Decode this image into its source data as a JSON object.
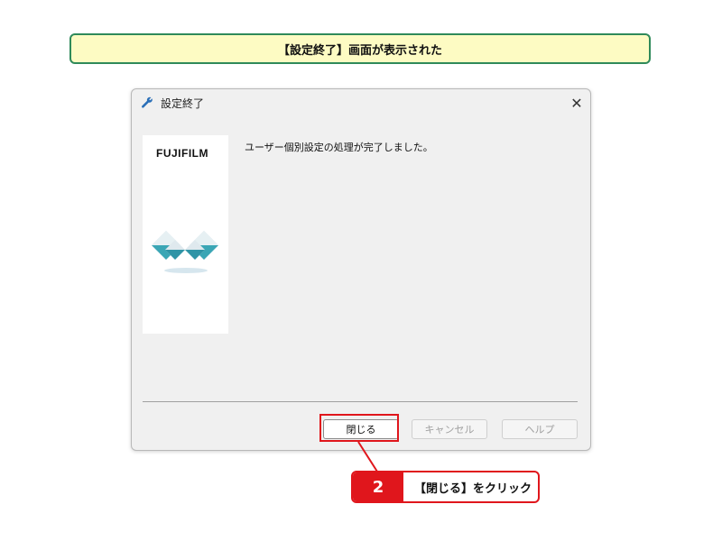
{
  "banner": {
    "text": "【設定終了】画面が表示された"
  },
  "dialog": {
    "title": "設定終了",
    "close_glyph": "✕",
    "brand": "FUJIFILM",
    "message": "ユーザー個別設定の処理が完了しました。",
    "buttons": {
      "close_label": "閉じる",
      "cancel_label": "キャンセル",
      "help_label": "ヘルプ"
    },
    "icons": {
      "title": "wrench-icon",
      "close": "close-icon"
    }
  },
  "callout": {
    "step_number": "2",
    "text": "【閉じる】をクリック"
  },
  "colors": {
    "banner_bg": "#fdfbc3",
    "banner_border": "#2f8a5a",
    "callout_red": "#e0161c",
    "brand_mark_teal": "#3aa6b5"
  }
}
